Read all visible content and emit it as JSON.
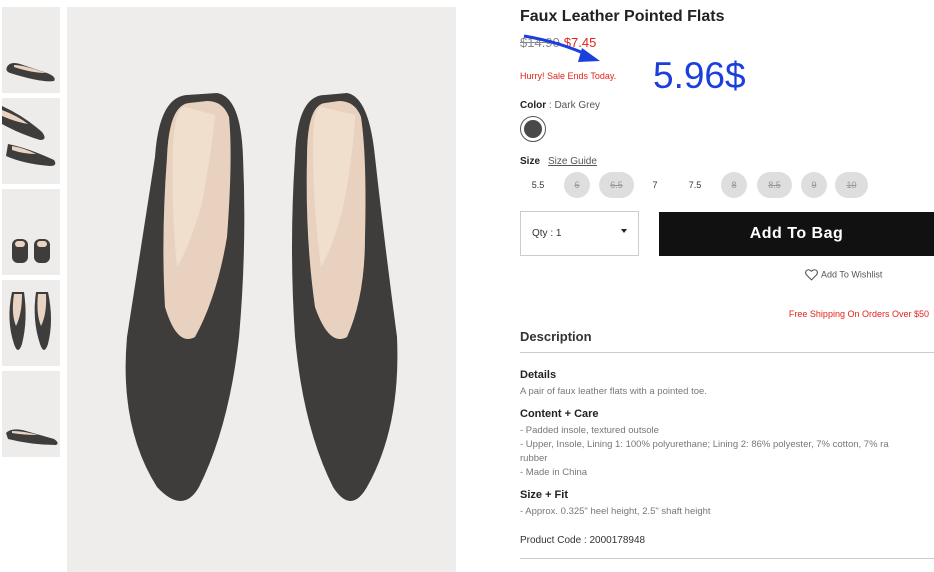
{
  "product": {
    "title": "Faux Leather Pointed Flats",
    "old_price": "$14.90",
    "sale_price": "$7.45",
    "hurry": "Hurry! Sale Ends Today.",
    "annotation": "5.96$",
    "color_label": "Color",
    "color_sep": ":",
    "color_value": "Dark Grey",
    "size_label": "Size",
    "size_guide": "Size Guide",
    "sizes": [
      {
        "label": "5.5",
        "available": true
      },
      {
        "label": "6",
        "available": false
      },
      {
        "label": "6.5",
        "available": false
      },
      {
        "label": "7",
        "available": true
      },
      {
        "label": "7.5",
        "available": true
      },
      {
        "label": "8",
        "available": false
      },
      {
        "label": "8.5",
        "available": false
      },
      {
        "label": "9",
        "available": false
      },
      {
        "label": "10",
        "available": false
      }
    ],
    "qty": "Qty : 1",
    "add_to_bag": "Add To Bag",
    "wishlist": "Add To Wishlist",
    "free_shipping": "Free Shipping On Orders Over $50",
    "description_heading": "Description",
    "details_heading": "Details",
    "details_text": "A pair of faux leather flats with a pointed toe.",
    "care_heading": "Content + Care",
    "care_lines": [
      "- Padded insole, textured outsole",
      "- Upper, Insole, Lining 1: 100% polyurethane; Lining 2: 86% polyester, 7% cotton, 7% ra",
      "rubber",
      "- Made in China"
    ],
    "fit_heading": "Size + Fit",
    "fit_text": "- Approx. 0.325\" heel height, 2.5\" shaft height",
    "product_code": "Product Code : 2000178948"
  },
  "colors": {
    "sale": "#e2231a",
    "annotation": "#1b3fdd",
    "button": "#111111",
    "shoe": "#3f3d3b"
  }
}
